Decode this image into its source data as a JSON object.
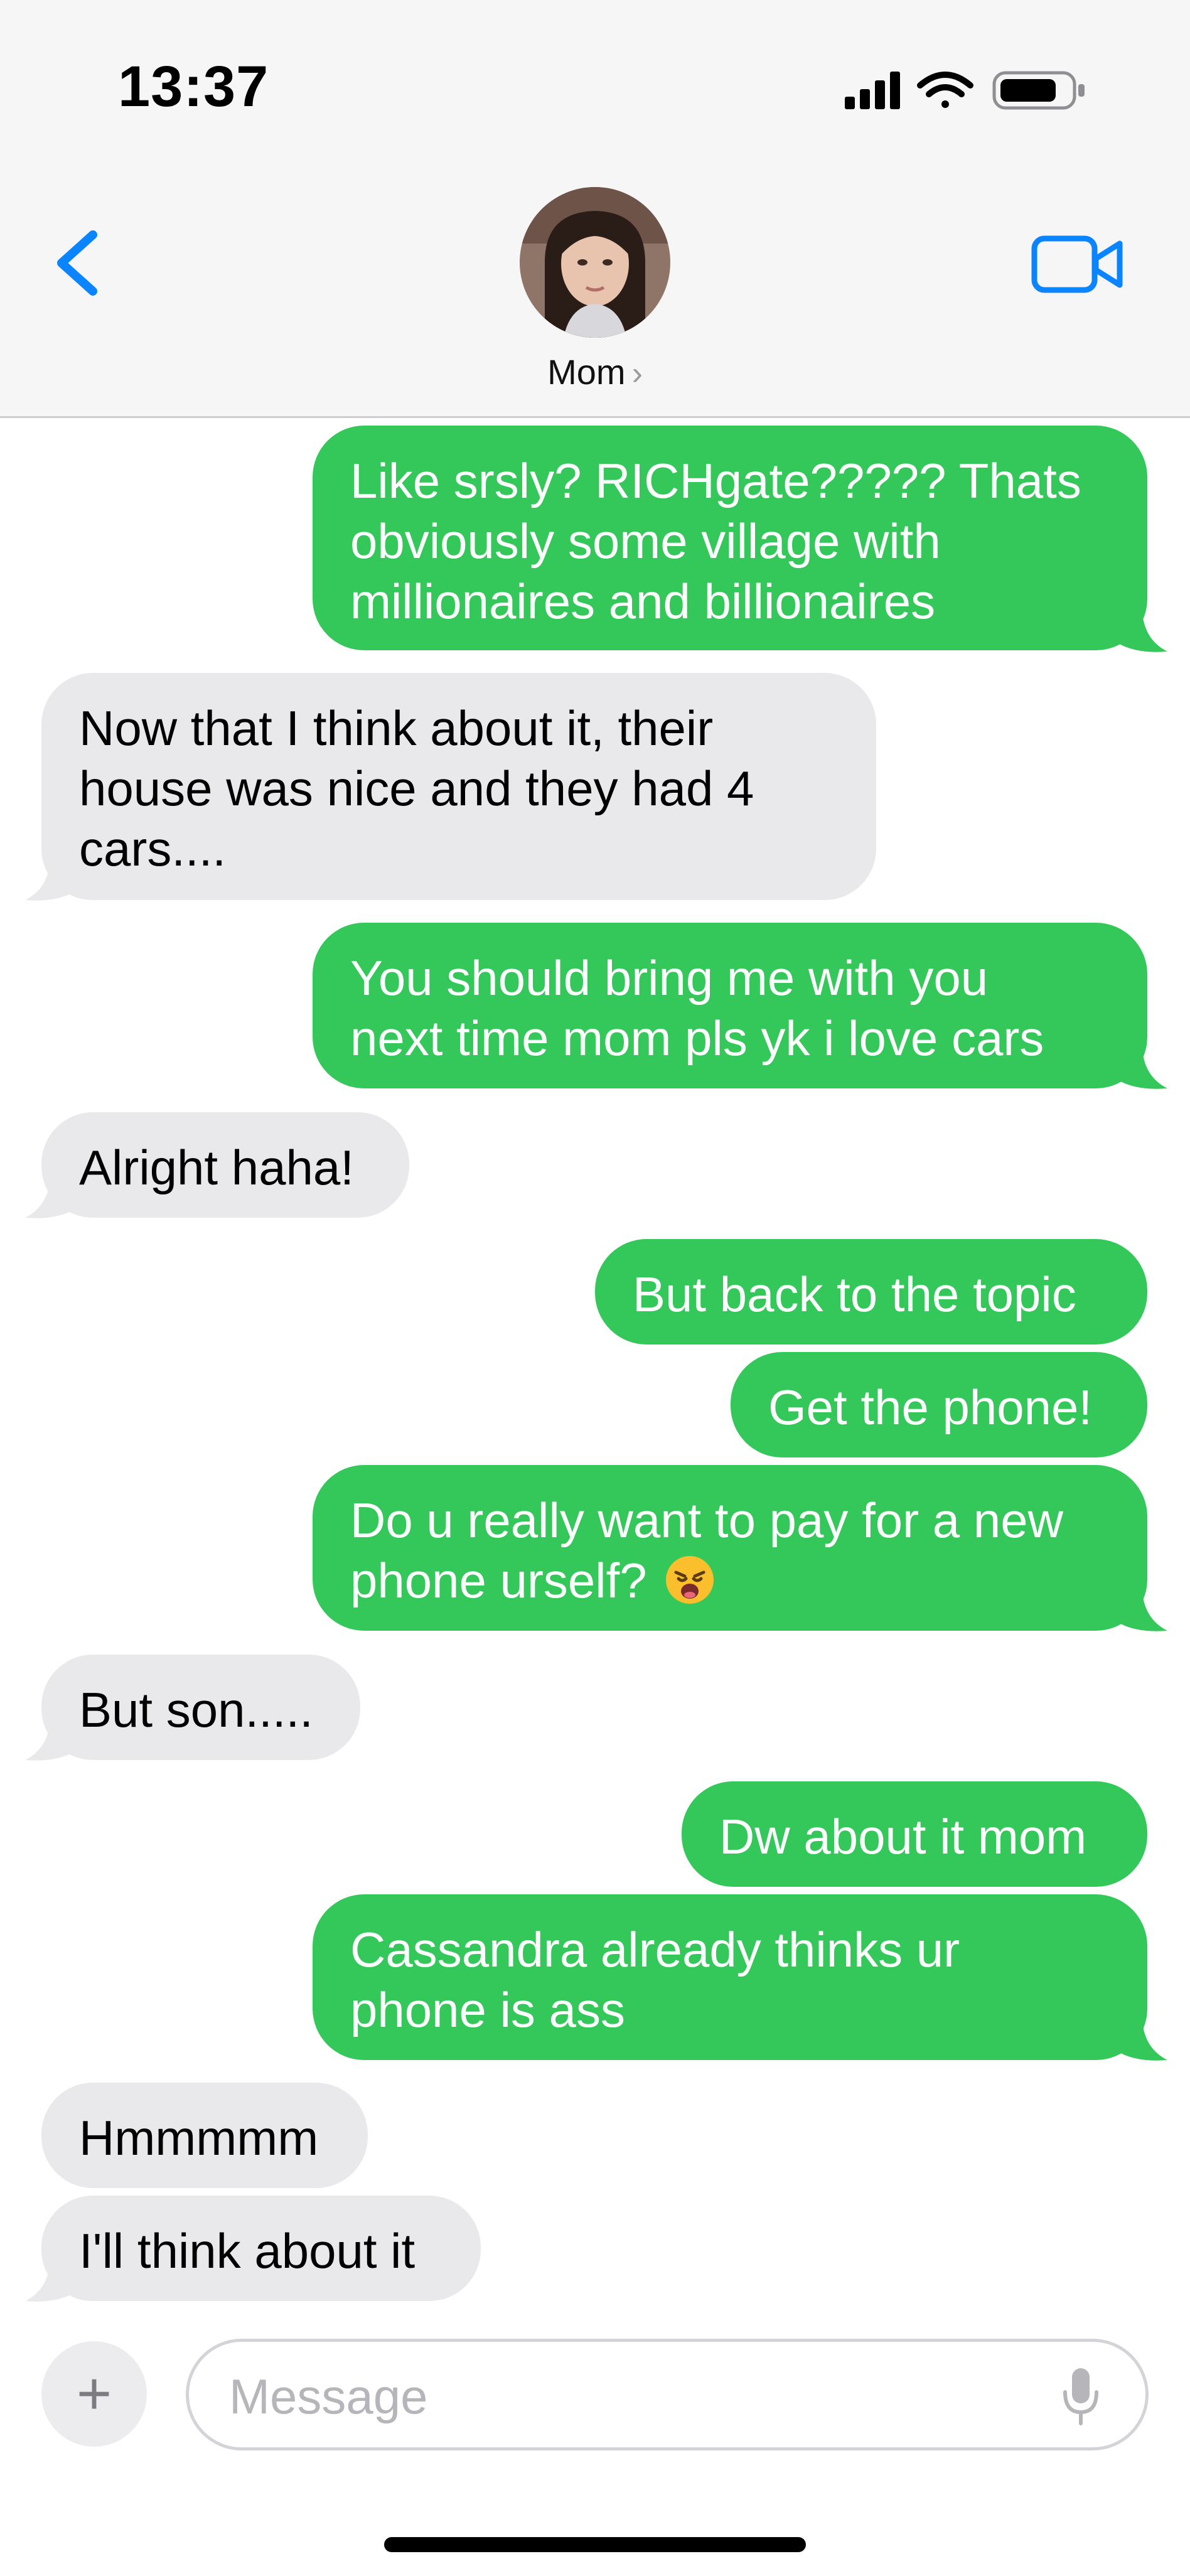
{
  "status_bar": {
    "time": "13:37"
  },
  "header": {
    "contact_name": "Mom",
    "name_chevron": "›"
  },
  "icons": {
    "back": "chevron-left-icon",
    "video": "video-camera-icon",
    "signal": "cellular-signal-icon",
    "wifi": "wifi-icon",
    "battery": "battery-icon",
    "add": "plus-icon",
    "mic": "microphone-icon",
    "emoji": "weary-face-emoji"
  },
  "colors": {
    "outgoing_bubble": "#34c759",
    "incoming_bubble": "#e9e9eb",
    "accent": "#0a84ff"
  },
  "messages": [
    {
      "sender": "me",
      "lines": [
        "Like srsly? RICHgate????? Thats",
        "obviously some village with",
        "millionaires and billionaires"
      ]
    },
    {
      "sender": "mom",
      "lines": [
        "Now that I think about it, their",
        "house was nice and they had 4",
        "cars...."
      ]
    },
    {
      "sender": "me",
      "lines": [
        "You should bring me with you",
        "next time mom pls yk i love cars"
      ]
    },
    {
      "sender": "mom",
      "lines": [
        "Alright haha!"
      ]
    },
    {
      "sender": "me",
      "lines": [
        "But back to the topic"
      ]
    },
    {
      "sender": "me",
      "lines": [
        "Get the phone!"
      ]
    },
    {
      "sender": "me",
      "lines": [
        "Do u really want to pay for a new",
        "phone urself?"
      ]
    },
    {
      "sender": "mom",
      "lines": [
        "But son....."
      ]
    },
    {
      "sender": "me",
      "lines": [
        "Dw about it mom"
      ]
    },
    {
      "sender": "me",
      "lines": [
        "Cassandra already thinks ur",
        "phone is ass"
      ]
    },
    {
      "sender": "mom",
      "lines": [
        "Hmmmmm"
      ]
    },
    {
      "sender": "mom",
      "lines": [
        "I'll think about it"
      ]
    }
  ],
  "composer": {
    "placeholder": "Message",
    "add_label": "+"
  }
}
